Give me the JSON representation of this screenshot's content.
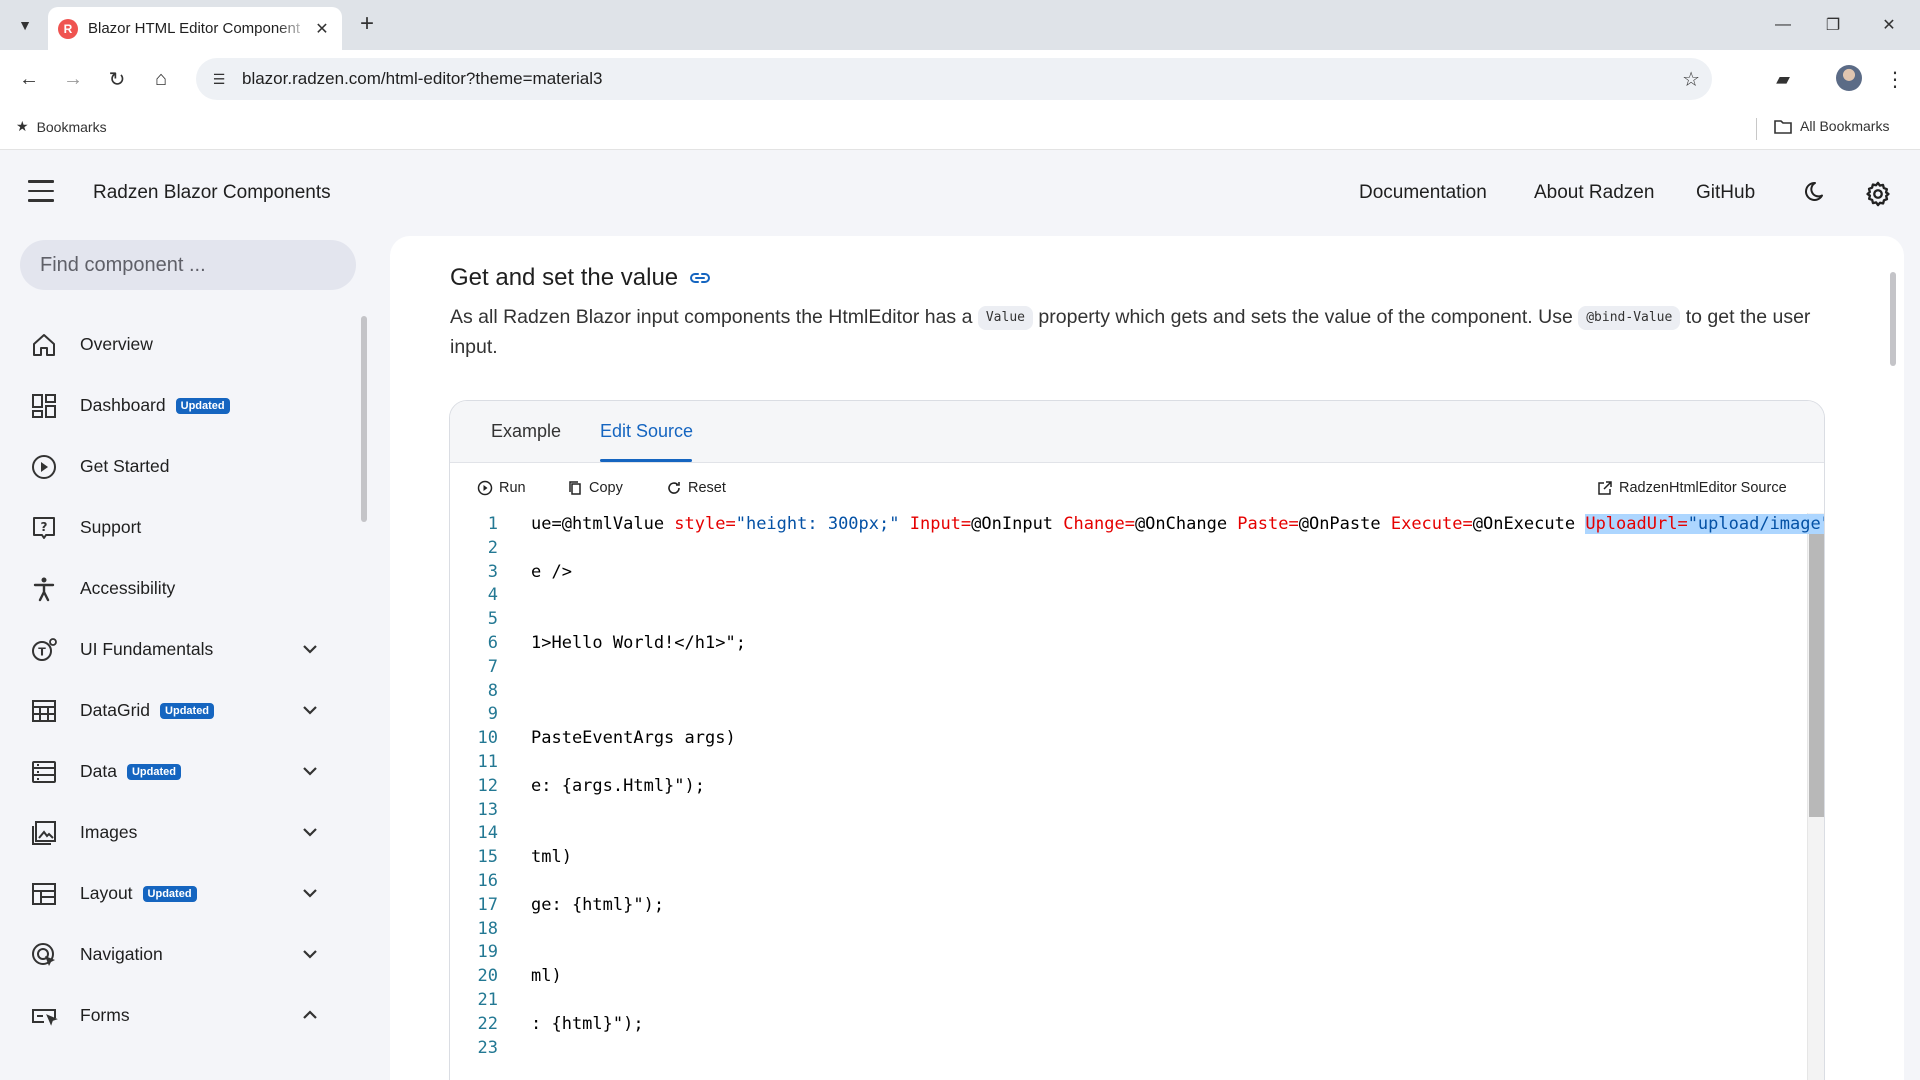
{
  "browser": {
    "tab_title": "Blazor HTML Editor Component",
    "url": "blazor.radzen.com/html-editor?theme=material3",
    "bookmarks_label": "Bookmarks",
    "all_bookmarks_label": "All Bookmarks"
  },
  "header": {
    "title": "Radzen Blazor Components",
    "links": [
      "Documentation",
      "About Radzen",
      "GitHub"
    ]
  },
  "sidebar": {
    "search_placeholder": "Find component ...",
    "items": [
      {
        "label": "Overview",
        "icon": "home-icon",
        "badge": "",
        "chevron": ""
      },
      {
        "label": "Dashboard",
        "icon": "dashboard-icon",
        "badge": "Updated",
        "chevron": ""
      },
      {
        "label": "Get Started",
        "icon": "play-circle-icon",
        "badge": "",
        "chevron": ""
      },
      {
        "label": "Support",
        "icon": "help-icon",
        "badge": "",
        "chevron": ""
      },
      {
        "label": "Accessibility",
        "icon": "accessibility-icon",
        "badge": "",
        "chevron": ""
      },
      {
        "label": "UI Fundamentals",
        "icon": "ui-fundamentals-icon",
        "badge": "",
        "chevron": "down"
      },
      {
        "label": "DataGrid",
        "icon": "grid-icon",
        "badge": "Updated",
        "chevron": "down"
      },
      {
        "label": "Data",
        "icon": "list-icon",
        "badge": "Updated",
        "chevron": "down"
      },
      {
        "label": "Images",
        "icon": "image-icon",
        "badge": "",
        "chevron": "down"
      },
      {
        "label": "Layout",
        "icon": "layout-icon",
        "badge": "Updated",
        "chevron": "down"
      },
      {
        "label": "Navigation",
        "icon": "navigation-icon",
        "badge": "",
        "chevron": "down"
      },
      {
        "label": "Forms",
        "icon": "forms-icon",
        "badge": "",
        "chevron": "up"
      }
    ]
  },
  "main": {
    "section_title": "Get and set the value",
    "desc_part1": "As all Radzen Blazor input components the HtmlEditor has a ",
    "desc_code1": "Value",
    "desc_part2": " property which gets and sets the value of the component. Use ",
    "desc_code2": "@bind-Value",
    "desc_part3": " to get the user input.",
    "tabs": [
      "Example",
      "Edit Source"
    ],
    "active_tab": "Edit Source",
    "actions": {
      "run": "Run",
      "copy": "Copy",
      "reset": "Reset",
      "source": "RadzenHtmlEditor Source"
    },
    "code_lines": [
      {
        "n": "1",
        "tokens": [
          {
            "t": "ue=@htmlValue ",
            "c": ""
          },
          {
            "t": "style=",
            "c": "attr"
          },
          {
            "t": "\"height: 300px;\"",
            "c": "str"
          },
          {
            "t": " ",
            "c": ""
          },
          {
            "t": "Input=",
            "c": "attr"
          },
          {
            "t": "@OnInput ",
            "c": ""
          },
          {
            "t": "Change=",
            "c": "attr"
          },
          {
            "t": "@OnChange ",
            "c": ""
          },
          {
            "t": "Paste=",
            "c": "attr"
          },
          {
            "t": "@OnPaste ",
            "c": ""
          },
          {
            "t": "Execute=",
            "c": "attr"
          },
          {
            "t": "@OnExecute ",
            "c": ""
          },
          {
            "t": "UploadUrl=",
            "c": "attr sel"
          },
          {
            "t": "\"upload/image\"",
            "c": "str sel"
          },
          {
            "t": " />",
            "c": ""
          }
        ]
      },
      {
        "n": "2",
        "tokens": []
      },
      {
        "n": "3",
        "tokens": [
          {
            "t": "e />",
            "c": ""
          }
        ]
      },
      {
        "n": "4",
        "tokens": []
      },
      {
        "n": "5",
        "tokens": []
      },
      {
        "n": "6",
        "tokens": [
          {
            "t": "1>Hello World!</h1>\";",
            "c": ""
          }
        ]
      },
      {
        "n": "7",
        "tokens": []
      },
      {
        "n": "8",
        "tokens": []
      },
      {
        "n": "9",
        "tokens": []
      },
      {
        "n": "10",
        "tokens": [
          {
            "t": "PasteEventArgs args)",
            "c": ""
          }
        ]
      },
      {
        "n": "11",
        "tokens": []
      },
      {
        "n": "12",
        "tokens": [
          {
            "t": "e: {args.Html}\");",
            "c": ""
          }
        ]
      },
      {
        "n": "13",
        "tokens": []
      },
      {
        "n": "14",
        "tokens": []
      },
      {
        "n": "15",
        "tokens": [
          {
            "t": "tml)",
            "c": ""
          }
        ]
      },
      {
        "n": "16",
        "tokens": []
      },
      {
        "n": "17",
        "tokens": [
          {
            "t": "ge: {html}\");",
            "c": ""
          }
        ]
      },
      {
        "n": "18",
        "tokens": []
      },
      {
        "n": "19",
        "tokens": []
      },
      {
        "n": "20",
        "tokens": [
          {
            "t": "ml)",
            "c": ""
          }
        ]
      },
      {
        "n": "21",
        "tokens": []
      },
      {
        "n": "22",
        "tokens": [
          {
            "t": ": {html}\");",
            "c": ""
          }
        ]
      },
      {
        "n": "23",
        "tokens": []
      }
    ]
  },
  "colors": {
    "accent": "#1565c0",
    "badge_bg": "#1565c0",
    "page_bg": "#f4f5f9",
    "selection": "#add6ff"
  }
}
